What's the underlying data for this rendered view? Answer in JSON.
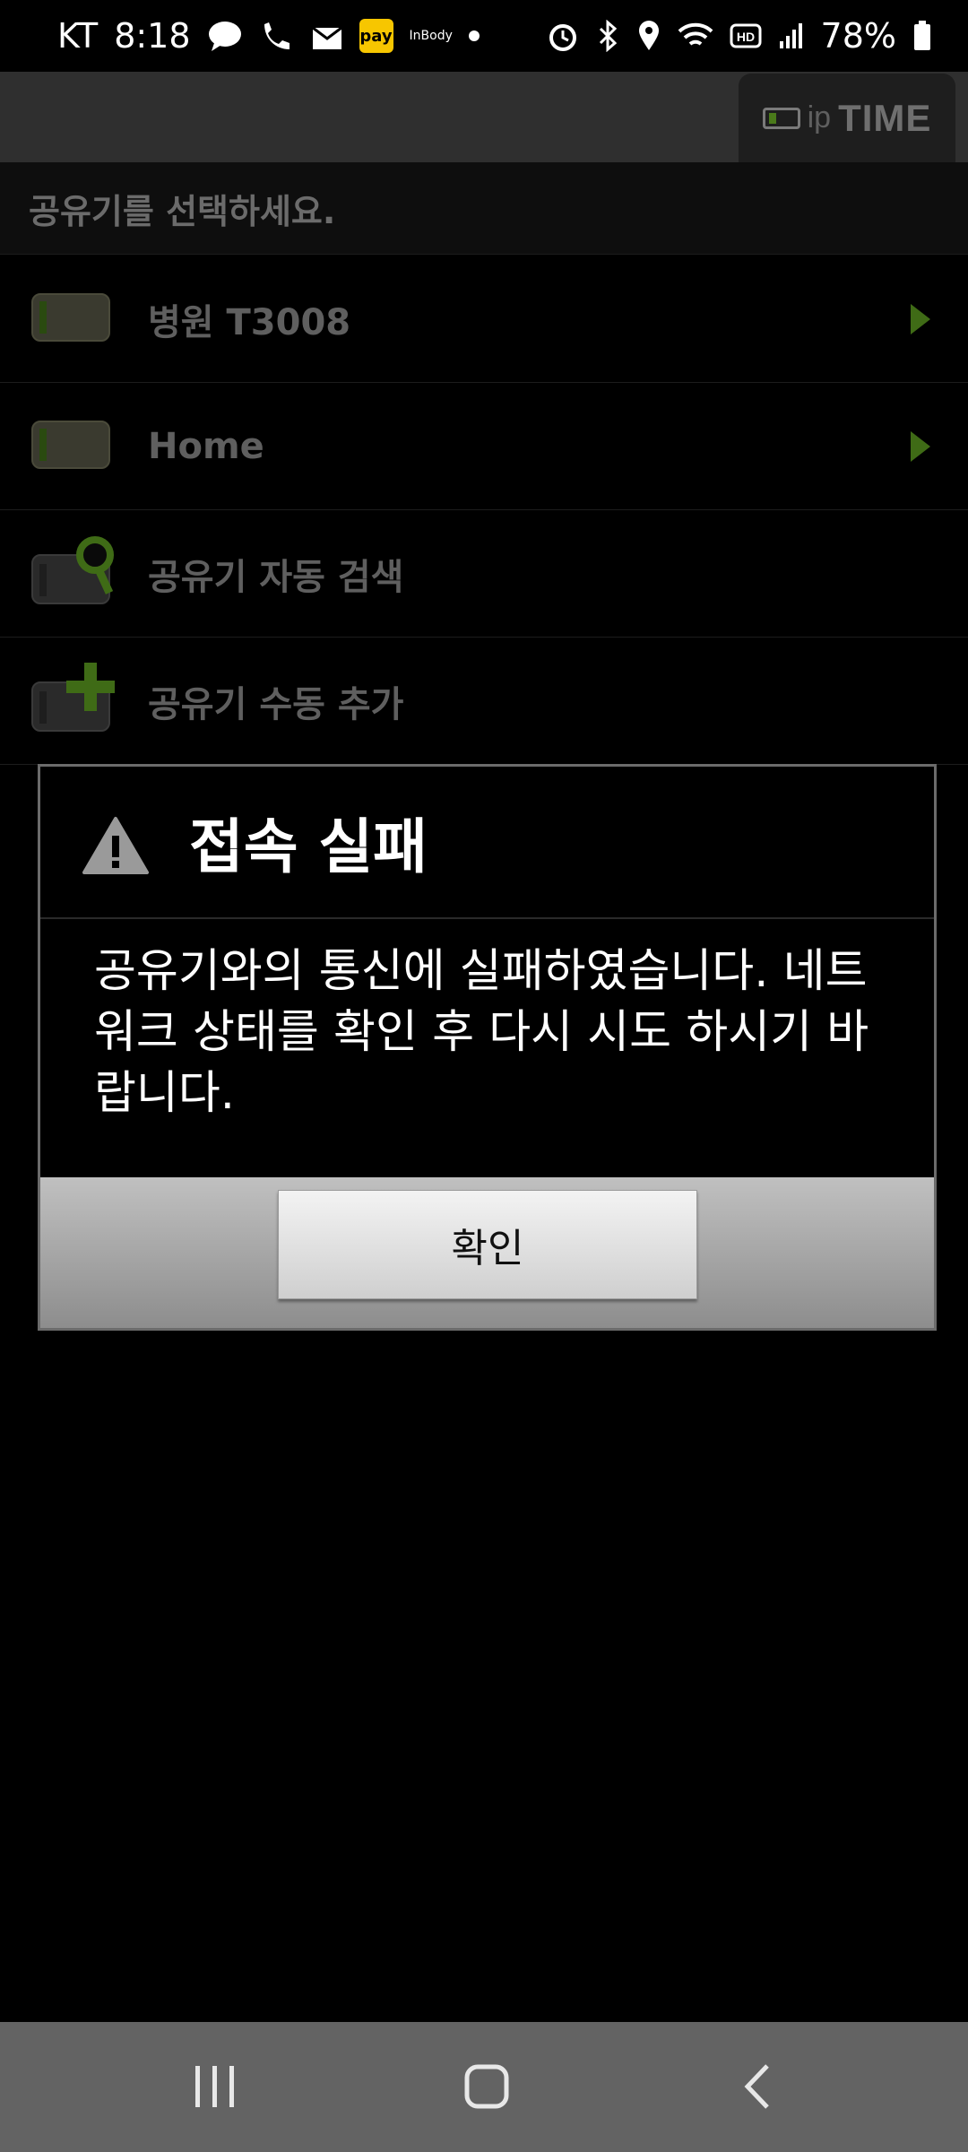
{
  "status_bar": {
    "carrier": "KT",
    "time": "8:18",
    "battery": "78%",
    "left_icons": [
      "chat-bubble-icon",
      "whowho-icon",
      "mail-icon",
      "kakaopay-icon",
      "inbody-icon",
      "dot-icon"
    ],
    "right_icons": [
      "alarm-icon",
      "bluetooth-icon",
      "location-icon",
      "wifi-icon",
      "hd-icon",
      "signal-icon",
      "battery-icon"
    ],
    "inbody_label": "InBody"
  },
  "header": {
    "logo_ip": "ip",
    "logo_time": "TIME"
  },
  "list": {
    "title": "공유기를 선택하세요.",
    "items": [
      {
        "label": "병원 T3008",
        "icon": "router-icon",
        "has_arrow": true
      },
      {
        "label": "Home",
        "icon": "router-icon",
        "has_arrow": true
      },
      {
        "label": "공유기 자동 검색",
        "icon": "router-search-icon",
        "has_arrow": false
      },
      {
        "label": "공유기 수동 추가",
        "icon": "router-add-icon",
        "has_arrow": false
      }
    ]
  },
  "dialog": {
    "title": "접속 실패",
    "message": "공유기와의 통신에 실패하였습니다. 네트워크 상태를 확인 후 다시 시도 하시기 바랍니다.",
    "ok_label": "확인"
  },
  "nav": {
    "icons": [
      "recents-icon",
      "home-icon",
      "back-icon"
    ]
  },
  "colors": {
    "accent_green": "#3f6b16",
    "dialog_border": "#6b6b6b",
    "header_bg": "#2f2f2f"
  }
}
